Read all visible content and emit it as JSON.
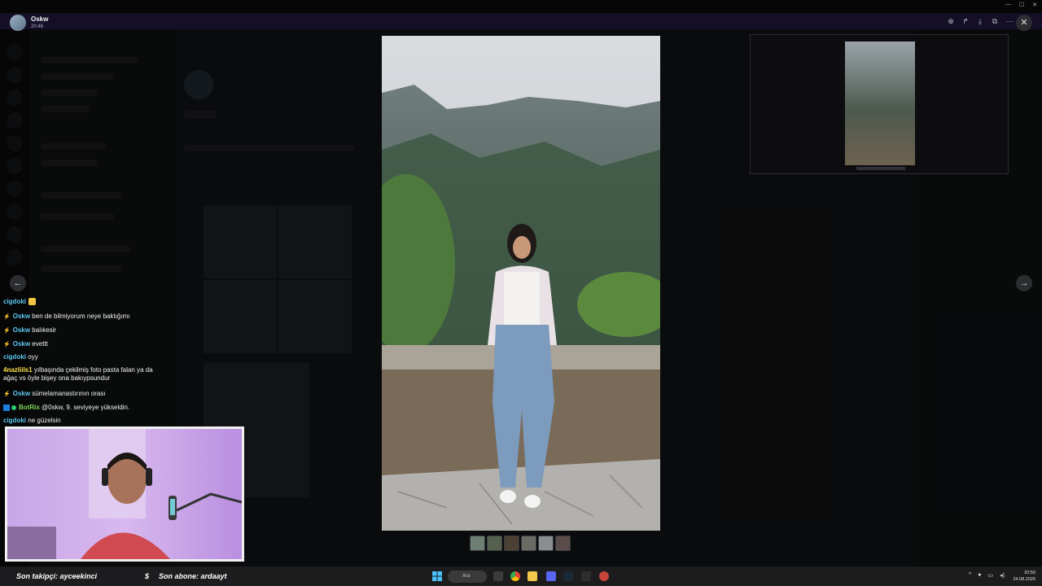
{
  "viewer": {
    "user": "Oskw",
    "time": "20:46",
    "header_icons": [
      "zoom-in-icon",
      "forward-icon",
      "download-icon",
      "open-external-icon",
      "more-icon"
    ],
    "close_label": "✕",
    "prev_label": "←",
    "next_label": "→"
  },
  "chat": {
    "messages": [
      {
        "user": "cigdoki",
        "text": "",
        "user_color": "#5ec8f2",
        "badge": "none",
        "emoji": true
      },
      {
        "user": "Oskw",
        "text": "ben de bilmiyorum neye baktığımı",
        "user_color": "#5ec8f2",
        "badge": "bolt"
      },
      {
        "user": "Oskw",
        "text": "balıkesir",
        "user_color": "#5ec8f2",
        "badge": "bolt"
      },
      {
        "user": "Oskw",
        "text": "evettt",
        "user_color": "#5ec8f2",
        "badge": "bolt"
      },
      {
        "user": "cigdoki",
        "text": "oyy",
        "user_color": "#5ec8f2",
        "badge": "none"
      },
      {
        "user": "4nazliils1",
        "text": "yılbaşında çekilmiş foto pasta falan ya da ağaç vs öyle bişey ona bakıypsundur",
        "user_color": "#ffe14d",
        "badge": "none"
      },
      {
        "user": "Oskw",
        "text": "sümelamanastırının orası",
        "user_color": "#5ec8f2",
        "badge": "bolt"
      },
      {
        "user": "BotRix",
        "text": "@0skw, 9. seviyeye yükseldin.",
        "user_color": "#7dd65b",
        "badge": "bot"
      },
      {
        "user": "cigdoki",
        "text": "ne güzelsin",
        "user_color": "#5ec8f2",
        "badge": "none"
      }
    ]
  },
  "stream_bar": {
    "follower_label": "Son takipçi: ayceekinci",
    "sub_label": "Son abone: ardaayt"
  },
  "taskbar": {
    "search_placeholder": "Ara",
    "clock_time": "20:50",
    "clock_date": "24.08.2026"
  },
  "colors": {
    "accent": "#5865f2",
    "twitch_purple": "#9146ff",
    "background": "#1a1b1e"
  }
}
